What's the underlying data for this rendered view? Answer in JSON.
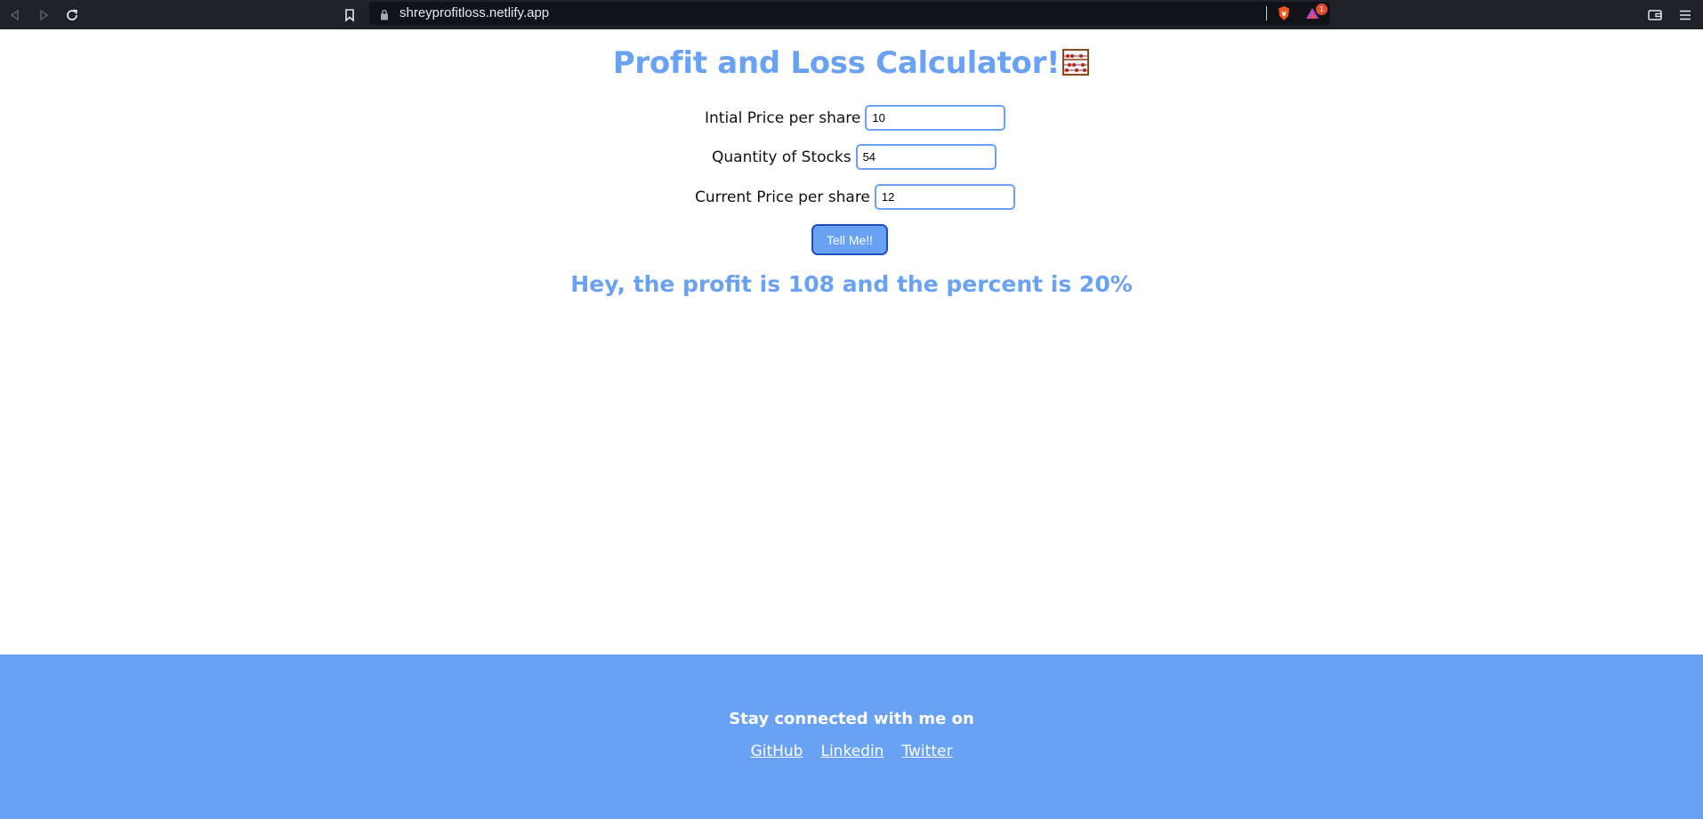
{
  "browser": {
    "url": "shreyprofitloss.netlify.app",
    "notification_count": "1"
  },
  "page": {
    "title": "Profit and Loss Calculator!",
    "fields": [
      {
        "label": "Intial Price per share",
        "value": "10"
      },
      {
        "label": "Quantity of Stocks",
        "value": "54"
      },
      {
        "label": "Current Price per share",
        "value": "12"
      }
    ],
    "button_label": "Tell Me!!",
    "result": "Hey, the profit is 108 and the percent is 20%"
  },
  "footer": {
    "heading": "Stay connected with me on",
    "links": [
      "GitHub",
      "Linkedin",
      "Twitter"
    ]
  },
  "icons": {
    "back": "back-arrow-icon",
    "forward": "forward-arrow-icon",
    "reload": "reload-icon",
    "bookmark": "bookmark-icon",
    "lock": "lock-icon",
    "shield": "brave-shield-icon",
    "rewards": "brave-rewards-icon",
    "wallet": "wallet-icon",
    "menu": "hamburger-menu-icon",
    "title_emoji": "abacus-icon"
  },
  "colors": {
    "accent": "#6aa2f3",
    "button_border": "#1e4fb8",
    "browser_bar": "#1f2129"
  }
}
